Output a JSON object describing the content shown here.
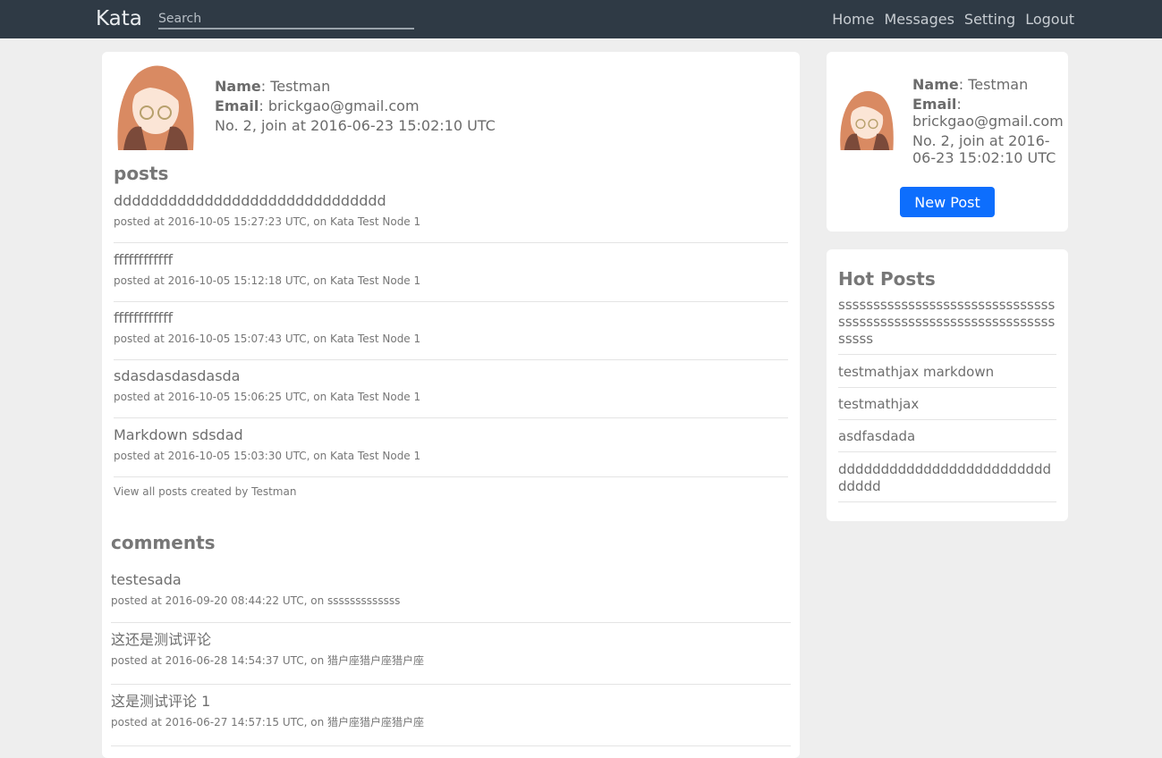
{
  "navbar": {
    "brand": "Kata",
    "search_placeholder": "Search",
    "links": [
      "Home",
      "Messages",
      "Setting",
      "Logout"
    ]
  },
  "profile": {
    "name_label": "Name",
    "name_value": ": Testman",
    "email_label": "Email",
    "email_value": ": brickgao@gmail.com",
    "joined": "No. 2, join at 2016-06-23 15:02:10 UTC"
  },
  "posts": {
    "title": "posts",
    "items": [
      {
        "title": "dddddddddddddddddddddddddddddd",
        "meta": "posted at 2016-10-05 15:27:23 UTC, on Kata Test Node 1"
      },
      {
        "title": "ffffffffffff",
        "meta": "posted at 2016-10-05 15:12:18 UTC, on Kata Test Node 1"
      },
      {
        "title": "ffffffffffff",
        "meta": "posted at 2016-10-05 15:07:43 UTC, on Kata Test Node 1"
      },
      {
        "title": "sdasdasdasdasda",
        "meta": "posted at 2016-10-05 15:06:25 UTC, on Kata Test Node 1"
      },
      {
        "title": "Markdown sdsdad",
        "meta": "posted at 2016-10-05 15:03:30 UTC, on Kata Test Node 1"
      }
    ],
    "view_all": "View all posts created by Testman"
  },
  "comments": {
    "title": "comments",
    "items": [
      {
        "title": "testesada",
        "meta": "posted at 2016-09-20 08:44:22 UTC, on sssssssssssss"
      },
      {
        "title": "这还是测试评论",
        "meta": "posted at 2016-06-28 14:54:37 UTC, on 猎户座猎户座猎户座"
      },
      {
        "title": "这是测试评论 1",
        "meta": "posted at 2016-06-27 14:57:15 UTC, on 猎户座猎户座猎户座"
      }
    ]
  },
  "sidebar": {
    "name_label": "Name",
    "name_value": ": Testman",
    "email_label": "Email",
    "email_value": ":",
    "email_address": "brickgao@gmail.com",
    "joined": "No. 2, join at 2016-06-23 15:02:10 UTC",
    "new_post": "New Post"
  },
  "hot_posts": {
    "title": "Hot Posts",
    "items": [
      "sssssssssssssssssssssssssssssssssssssssssssssssssssssssssssssssssss",
      "testmathjax markdown",
      "testmathjax",
      "asdfasdada",
      "dddddddddddddddddddddddddddddd"
    ]
  },
  "colors": {
    "navbar_bg": "#2f3a45",
    "page_bg": "#eeeeee",
    "primary_button": "#0d6efd"
  }
}
